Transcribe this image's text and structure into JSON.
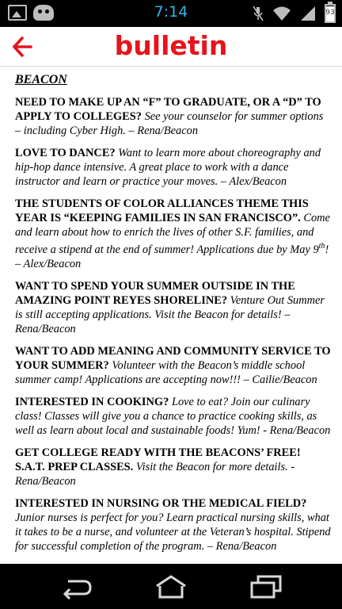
{
  "status_bar": {
    "time": "7:14",
    "battery": "93",
    "battery_level": 0.93,
    "icons": [
      "image-icon",
      "game-controller-icon",
      "mute-icon",
      "wifi-icon",
      "signal-icon",
      "battery-icon"
    ]
  },
  "app_bar": {
    "title": "bulletin",
    "back_icon": "back-arrow-icon",
    "accent": "#e5141c"
  },
  "content": {
    "section_title": "BEACON",
    "items": [
      {
        "heading": "NEED TO MAKE UP AN “F” TO GRADUATE, OR A “D” TO APPLY TO COLLEGES?",
        "body": "See your counselor for summer options – including Cyber High.",
        "credit": "– Rena/Beacon"
      },
      {
        "heading": "LOVE TO DANCE?",
        "body": "Want to learn more about choreography and hip-hop dance intensive.  A great place to work with a dance instructor and learn or practice your moves. – Alex/Beacon",
        "credit": ""
      },
      {
        "heading": "THE STUDENTS OF COLOR ALLIANCES THEME THIS YEAR IS “KEEPING FAMILIES IN SAN FRANCISCO”.",
        "body": "Come and learn about how to enrich the lives of other S.F. families, and receive a stipend at the end of summer! Applications due by May 9",
        "sup": "th",
        "body_end": "! – Alex/Beacon"
      },
      {
        "heading": "WANT TO SPEND YOUR SUMMER OUTSIDE IN THE AMAZING POINT REYES SHORELINE?",
        "body": "Venture Out Summer is still accepting applications.  Visit the Beacon for details! – Rena/Beacon",
        "credit": ""
      },
      {
        "heading": "WANT TO ADD MEANING AND COMMUNITY SERVICE TO YOUR SUMMER?",
        "body": "Volunteer with the Beacon’s middle school summer camp!  Applications are accepting now!!! – Cailie/Beacon",
        "credit": ""
      },
      {
        "heading": "INTERESTED IN COOKING?",
        "body": "Love to eat?  Join our culinary class!  Classes will give you a chance to practice cooking skills, as well as learn about local and sustainable foods!  Yum!  - Rena/Beacon",
        "credit": ""
      },
      {
        "heading": "GET COLLEGE READY WITH THE BEACONS’ FREE! S.A.T. PREP CLASSES.",
        "body": "Visit the Beacon for more details. - Rena/Beacon",
        "credit": ""
      },
      {
        "heading": "INTERESTED IN NURSING OR THE MEDICAL FIELD?",
        "body": "Junior nurses is perfect for you?  Learn practical nursing skills, what it takes to be a nurse, and volunteer at the Veteran’s hospital.  Stipend for successful completion of the program. – Rena/Beacon",
        "credit": ""
      }
    ]
  },
  "nav_bar": {
    "icons": [
      "back-icon",
      "home-icon",
      "recent-apps-icon"
    ]
  }
}
